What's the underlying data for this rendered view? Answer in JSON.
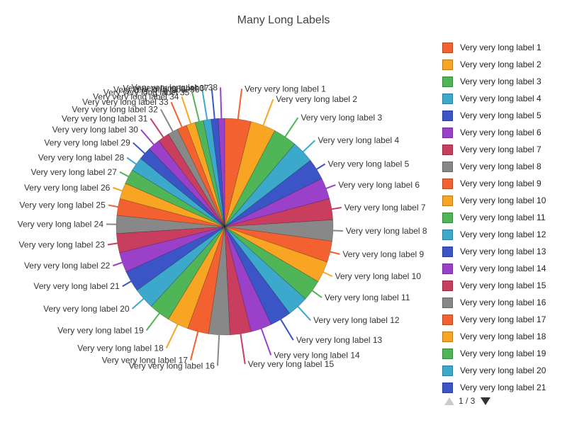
{
  "chart_data": {
    "type": "pie",
    "title": "Many Long Labels",
    "categories": [
      "Very very long label 1",
      "Very very long label 2",
      "Very very long label 3",
      "Very very long label 4",
      "Very very long label 5",
      "Very very long label 6",
      "Very very long label 7",
      "Very very long label 8",
      "Very very long label 9",
      "Very very long label 10",
      "Very very long label 11",
      "Very very long label 12",
      "Very very long label 13",
      "Very very long label 14",
      "Very very long label 15",
      "Very very long label 16",
      "Very very long label 17",
      "Very very long label 18",
      "Very very long label 19",
      "Very very long label 20",
      "Very very long label 21",
      "Very very long label 22",
      "Very very long label 23",
      "Very very long label 24",
      "Very very long label 25",
      "Very very long label 26",
      "Very very long label 27",
      "Very very long label 28",
      "Very very long label 29",
      "Very very long label 30",
      "Very very long label 31",
      "Very very long label 32",
      "Very very long label 33",
      "Very very long label 34",
      "Very very long label 35",
      "Very very long label 36",
      "Very very long label 37",
      "Very very long label 38"
    ],
    "values": [
      [
        4.1,
        3.9,
        3.7,
        3.5,
        3.3,
        3.3,
        3.3,
        3.3,
        3.3,
        3.3,
        3.3,
        3.3,
        3.3,
        3.3,
        3.3,
        3.3,
        3.3,
        3.3,
        3.3,
        3.3,
        3.3,
        3.1,
        3.0,
        2.8,
        2.6,
        2.5,
        2.3,
        2.2,
        2.0,
        1.9,
        1.8,
        1.6,
        1.5,
        1.4,
        1.3,
        1.2,
        1.1,
        1.0
      ]
    ],
    "colors": [
      "#f46131",
      "#f9a524",
      "#4fb556",
      "#3ba8cc",
      "#3c55c6",
      "#9a40c9",
      "#c93d5f",
      "#888888"
    ],
    "legend": {
      "position": "right",
      "page": "1 / 3"
    }
  }
}
